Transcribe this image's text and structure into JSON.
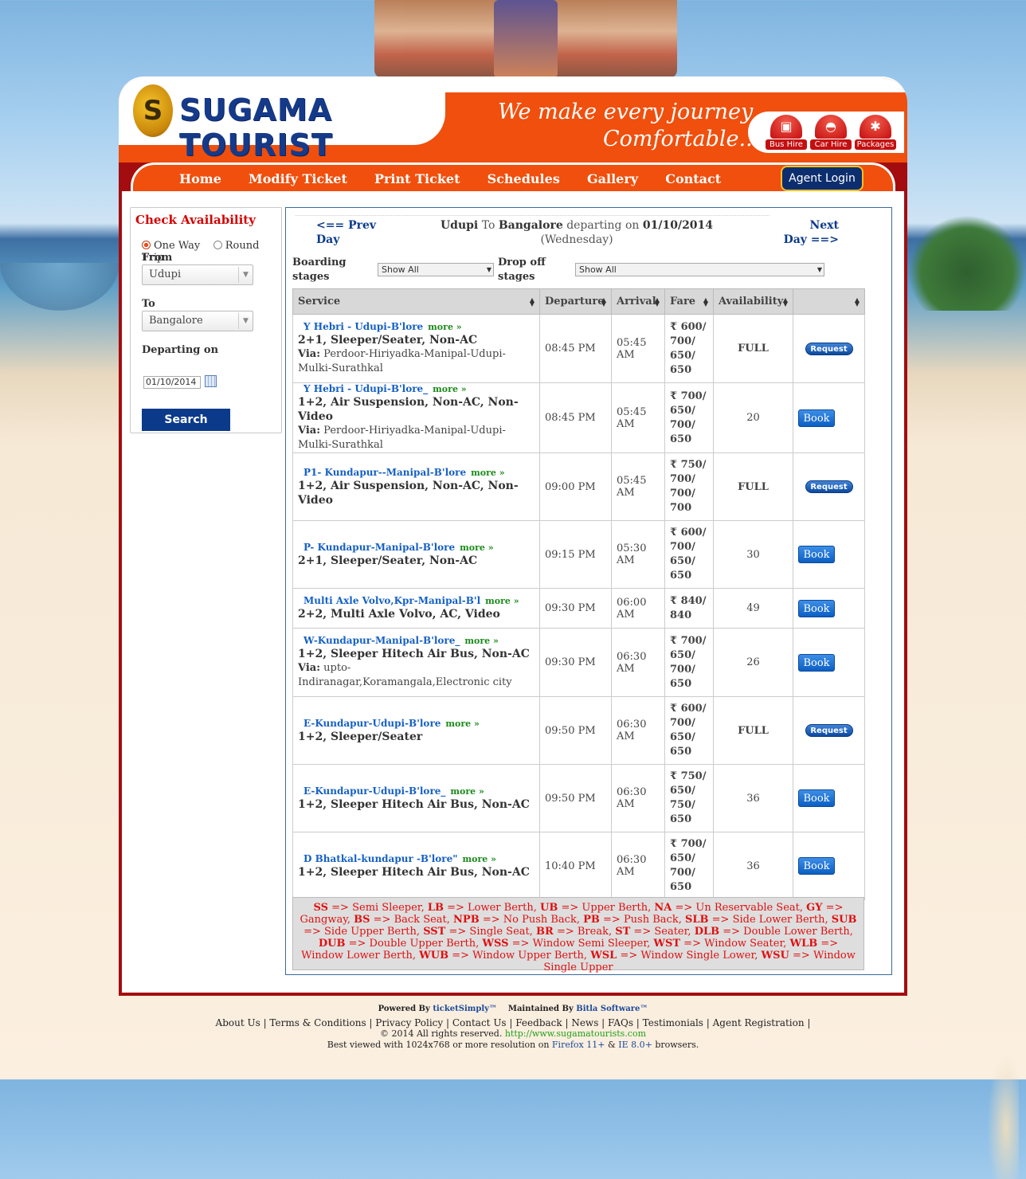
{
  "brand": {
    "logo_text": "SUGAMA TOURIST",
    "tagline_1": "We make every journey",
    "tagline_2": "Comfortable...",
    "quick_links": [
      "Bus Hire",
      "Car Hire",
      "Packages"
    ]
  },
  "nav": {
    "items": [
      "Home",
      "Modify Ticket",
      "Print Ticket",
      "Schedules",
      "Gallery",
      "Contact"
    ],
    "agent_login": "Agent Login"
  },
  "search": {
    "title": "Check Availability",
    "one_way": "One Way",
    "round_trip": "Round Trip",
    "from_label": "From",
    "from_value": "Udupi",
    "to_label": "To",
    "to_value": "Bangalore",
    "date_label": "Departing on",
    "date_value": "01/10/2014",
    "search_button": "Search"
  },
  "results": {
    "prev_day": "<== Prev Day",
    "next_day": "Next Day ==>",
    "from": "Udupi",
    "to_word": "To",
    "to": "Bangalore",
    "departing_on": "departing on",
    "date": "01/10/2014",
    "weekday": "(Wednesday)",
    "boarding_label": "Boarding stages",
    "boarding_value": "Show All",
    "dropoff_label": "Drop off stages",
    "dropoff_value": "Show All",
    "columns": [
      "Service",
      "Departure",
      "Arrival",
      "Fare",
      "Availability",
      ""
    ],
    "more_label": "more »",
    "via_label": "Via:",
    "rows": [
      {
        "name": "Y Hebri - Udupi-B'lore",
        "type": "2+1, Sleeper/Seater, Non-AC",
        "via": "Perdoor-Hiriyadka-Manipal-Udupi-Mulki-Surathkal",
        "departure": "08:45 PM",
        "arrival": "05:45 AM",
        "fare": "₹ 600/ 700/ 650/ 650",
        "availability": "FULL",
        "action": "Request"
      },
      {
        "name": "Y Hebri - Udupi-B'lore_",
        "type": "1+2, Air Suspension, Non-AC, Non-Video",
        "via": "Perdoor-Hiriyadka-Manipal-Udupi-Mulki-Surathkal",
        "departure": "08:45 PM",
        "arrival": "05:45 AM",
        "fare": "₹ 700/ 650/ 700/ 650",
        "availability": "20",
        "action": "Book"
      },
      {
        "name": "P1- Kundapur--Manipal-B'lore",
        "type": "1+2, Air Suspension, Non-AC, Non-Video",
        "via": "",
        "departure": "09:00 PM",
        "arrival": "05:45 AM",
        "fare": "₹ 750/ 700/ 700/ 700",
        "availability": "FULL",
        "action": "Request"
      },
      {
        "name": "P- Kundapur-Manipal-B'lore",
        "type": "2+1, Sleeper/Seater, Non-AC",
        "via": "",
        "departure": "09:15 PM",
        "arrival": "05:30 AM",
        "fare": "₹ 600/ 700/ 650/ 650",
        "availability": "30",
        "action": "Book"
      },
      {
        "name": "Multi Axle Volvo,Kpr-Manipal-B'l",
        "type": "2+2, Multi Axle Volvo, AC, Video",
        "via": "",
        "departure": "09:30 PM",
        "arrival": "06:00 AM",
        "fare": "₹ 840/ 840",
        "availability": "49",
        "action": "Book"
      },
      {
        "name": "W-Kundapur-Manipal-B'lore_",
        "type": "1+2, Sleeper Hitech Air Bus, Non-AC",
        "via": "upto-Indiranagar,Koramangala,Electronic city",
        "departure": "09:30 PM",
        "arrival": "06:30 AM",
        "fare": "₹ 700/ 650/ 700/ 650",
        "availability": "26",
        "action": "Book"
      },
      {
        "name": "E-Kundapur-Udupi-B'lore",
        "type": "1+2, Sleeper/Seater",
        "via": "",
        "departure": "09:50 PM",
        "arrival": "06:30 AM",
        "fare": "₹ 600/ 700/ 650/ 650",
        "availability": "FULL",
        "action": "Request"
      },
      {
        "name": "E-Kundapur-Udupi-B'lore_",
        "type": "1+2, Sleeper Hitech Air Bus, Non-AC",
        "via": "",
        "departure": "09:50 PM",
        "arrival": "06:30 AM",
        "fare": "₹ 750/ 650/ 750/ 650",
        "availability": "36",
        "action": "Book"
      },
      {
        "name": "D Bhatkal-kundapur -B'lore\"",
        "type": "1+2, Sleeper Hitech Air Bus, Non-AC",
        "via": "",
        "departure": "10:40 PM",
        "arrival": "06:30 AM",
        "fare": "₹ 700/ 650/ 700/ 650",
        "availability": "36",
        "action": "Book"
      }
    ],
    "legend": [
      [
        "SS",
        "Semi Sleeper"
      ],
      [
        "LB",
        "Lower Berth"
      ],
      [
        "UB",
        "Upper Berth"
      ],
      [
        "NA",
        "Un Reservable Seat"
      ],
      [
        "GY",
        "Gangway"
      ],
      [
        "BS",
        "Back Seat"
      ],
      [
        "NPB",
        "No Push Back"
      ],
      [
        "PB",
        "Push Back"
      ],
      [
        "SLB",
        "Side Lower Berth"
      ],
      [
        "SUB",
        "Side Upper Berth"
      ],
      [
        "SST",
        "Single Seat"
      ],
      [
        "BR",
        "Break"
      ],
      [
        "ST",
        "Seater"
      ],
      [
        "DLB",
        "Double Lower Berth"
      ],
      [
        "DUB",
        "Double Upper Berth"
      ],
      [
        "WSS",
        "Window Semi Sleeper"
      ],
      [
        "WST",
        "Window Seater"
      ],
      [
        "WLB",
        "Window Lower Berth"
      ],
      [
        "WUB",
        "Window Upper Berth"
      ],
      [
        "WSL",
        "Window Single Lower"
      ],
      [
        "WSU",
        "Window Single Upper"
      ]
    ]
  },
  "footer": {
    "powered_by": "Powered By",
    "ticket_simply": "ticketSimply™",
    "maintained_by": "Maintained By",
    "bitla": "Bitla Software™",
    "links": [
      "About Us",
      "Terms & Conditions",
      "Privacy Policy",
      "Contact Us",
      "Feedback",
      "News",
      "FAQs",
      "Testimonials",
      "Agent Registration"
    ],
    "copyright": "© 2014 All rights reserved.",
    "url": "http://www.sugamatourists.com",
    "best_viewed_pre": "Best viewed with 1024x768 or more resolution on",
    "firefox": "Firefox 11+",
    "amp": "&",
    "ie": "IE 8.0+",
    "browsers": "browsers."
  }
}
